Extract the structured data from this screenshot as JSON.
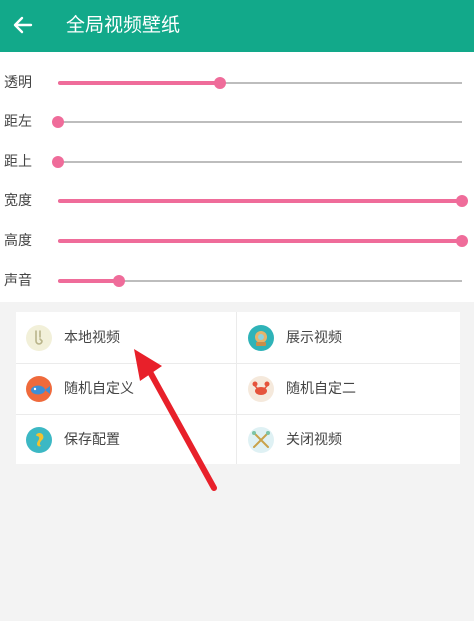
{
  "header": {
    "title": "全局视频壁纸",
    "back_icon": "arrow-left-icon"
  },
  "sliders": [
    {
      "id": "transparency",
      "label": "透明",
      "value": 0.4
    },
    {
      "id": "left",
      "label": "距左",
      "value": 0.0
    },
    {
      "id": "top",
      "label": "距上",
      "value": 0.0
    },
    {
      "id": "width",
      "label": "宽度",
      "value": 1.0
    },
    {
      "id": "height",
      "label": "高度",
      "value": 1.0
    },
    {
      "id": "sound",
      "label": "声音",
      "value": 0.15
    }
  ],
  "actions": [
    {
      "id": "local-video",
      "label": "本地视频",
      "icon": "fishhook-icon"
    },
    {
      "id": "show-video",
      "label": "展示视频",
      "icon": "diving-helmet-icon"
    },
    {
      "id": "random-custom-1",
      "label": "随机自定义",
      "icon": "fish-icon"
    },
    {
      "id": "random-custom-2",
      "label": "随机自定二",
      "icon": "crab-icon"
    },
    {
      "id": "save-config",
      "label": "保存配置",
      "icon": "seahorse-icon"
    },
    {
      "id": "close-video",
      "label": "关闭视频",
      "icon": "crossed-paddles-icon"
    }
  ],
  "colors": {
    "accent": "#12a98a",
    "slider": "#ef6c9a",
    "annotation_arrow": "#e8202a"
  }
}
